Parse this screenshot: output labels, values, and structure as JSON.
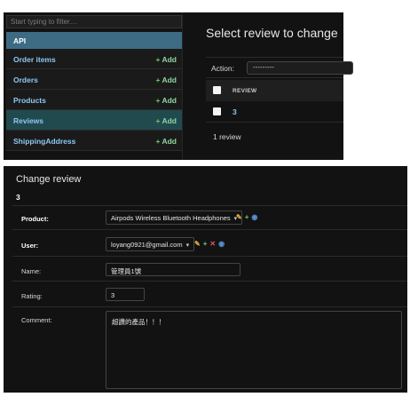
{
  "list_view": {
    "filter_placeholder": "Start typing to filter…",
    "app_name": "API",
    "models": [
      {
        "label": "Order items",
        "add": "Add"
      },
      {
        "label": "Orders",
        "add": "Add"
      },
      {
        "label": "Products",
        "add": "Add"
      },
      {
        "label": "Reviews",
        "add": "Add",
        "active": true
      },
      {
        "label": "ShippingAddress",
        "add": "Add"
      }
    ],
    "title": "Select review to change",
    "action_label": "Action:",
    "action_value": "---------",
    "column_header": "REVIEW",
    "rows": [
      "3"
    ],
    "result_count": "1 review"
  },
  "change_form": {
    "title": "Change review",
    "object": "3",
    "product": {
      "label": "Product:",
      "value": "Airpods Wireless Bluetooth Headphones"
    },
    "user": {
      "label": "User:",
      "value": "loyang0921@gmail.com"
    },
    "name": {
      "label": "Name:",
      "value": "管理員1號"
    },
    "rating": {
      "label": "Rating:",
      "value": "3"
    },
    "comment": {
      "label": "Comment:",
      "value": "超讚的產品！！！"
    }
  },
  "icons": {
    "add": "plus-icon",
    "edit": "pencil-icon",
    "delete": "close-icon",
    "view": "eye-icon",
    "dropdown": "chevron-down-icon"
  },
  "colors": {
    "background": "#121212",
    "app_header": "#3d6b84",
    "active_row": "#214a4f",
    "link": "#8fc7f3",
    "add_green": "#71c96b",
    "pencil": "#e2b13c",
    "delete_red": "#e25555",
    "view_blue": "#5b8fd6"
  }
}
